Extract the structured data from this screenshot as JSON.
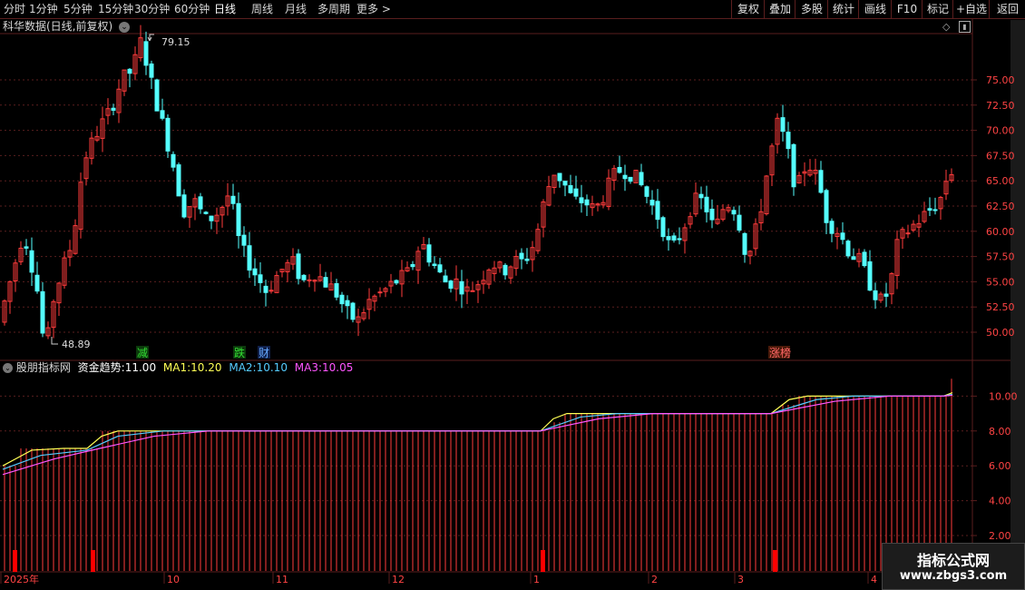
{
  "toolbar": {
    "periods": [
      "分时",
      "1分钟",
      "5分钟",
      "15分钟",
      "30分钟",
      "60分钟",
      "日线",
      "周线",
      "月线",
      "多周期",
      "更多 >"
    ],
    "active_period": "日线",
    "right_buttons": [
      "复权",
      "叠加",
      "多股",
      "统计",
      "画线",
      "F10",
      "标记",
      "+自选",
      "返回"
    ]
  },
  "main_panel": {
    "title": "科华数据(日线,前复权)",
    "high_label": "79.15",
    "low_label": "48.89",
    "y_ticks": [
      "75.00",
      "72.50",
      "70.00",
      "67.50",
      "65.00",
      "62.50",
      "60.00",
      "57.50",
      "55.00",
      "52.50",
      "50.00"
    ],
    "event_markers": [
      {
        "text": "减",
        "color": "#33dd33",
        "bg": "#0c3a0c"
      },
      {
        "text": "跌",
        "color": "#33dd33",
        "bg": "#0c3a0c"
      },
      {
        "text": "财",
        "color": "#66aaff",
        "bg": "#10204a"
      },
      {
        "text": "涨榜",
        "color": "#ff6666",
        "bg": "#4a1a0a"
      }
    ]
  },
  "indicator_panel": {
    "name": "股朋指标网",
    "series_label": "资金趋势:",
    "series_value": "11.00",
    "ma1_label": "MA1:",
    "ma1_value": "10.20",
    "ma2_label": "MA2:",
    "ma2_value": "10.10",
    "ma3_label": "MA3:",
    "ma3_value": "10.05",
    "y_ticks": [
      "10.00",
      "8.00",
      "6.00",
      "4.00",
      "2.00"
    ]
  },
  "x_axis": {
    "labels": [
      "2025年",
      "10",
      "11",
      "12",
      "1",
      "2",
      "3",
      "4"
    ]
  },
  "colors": {
    "up": "#ff3b3b",
    "down": "#54ffff",
    "grid": "#5a1e1e",
    "ma1": "#ffff55",
    "ma2": "#55ccff",
    "ma3": "#ff55ff"
  },
  "watermark": {
    "line1": "指标公式网",
    "line2": "www.zbgs3.com"
  }
}
